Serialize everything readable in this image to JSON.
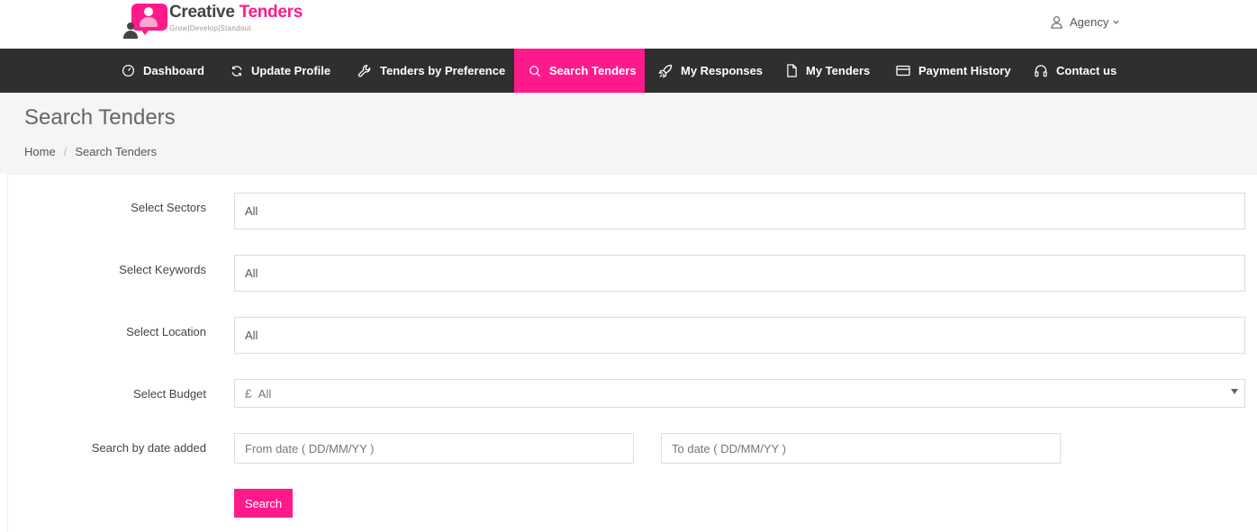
{
  "brand": {
    "name_part1": "Creative",
    "name_part2": "Tenders",
    "tagline": "Grow|Develop|Standout"
  },
  "user_menu": {
    "label": "Agency"
  },
  "nav": {
    "items": [
      {
        "label": "Dashboard",
        "icon": "gauge-icon"
      },
      {
        "label": "Update Profile",
        "icon": "refresh-icon"
      },
      {
        "label": "Tenders by Preference",
        "icon": "wrench-icon"
      },
      {
        "label": "Search Tenders",
        "icon": "search-icon",
        "active": true
      },
      {
        "label": "My Responses",
        "icon": "rocket-icon"
      },
      {
        "label": "My Tenders",
        "icon": "document-icon"
      },
      {
        "label": "Payment History",
        "icon": "credit-card-icon"
      },
      {
        "label": "Contact us",
        "icon": "headphones-icon"
      }
    ]
  },
  "page": {
    "title": "Search Tenders",
    "breadcrumb": [
      "Home",
      "Search Tenders"
    ]
  },
  "form": {
    "sectors": {
      "label": "Select Sectors",
      "value": "All"
    },
    "keywords": {
      "label": "Select Keywords",
      "value": "All"
    },
    "location": {
      "label": "Select Location",
      "value": "All"
    },
    "budget": {
      "label": "Select Budget",
      "value": "All",
      "currency_symbol": "£"
    },
    "date": {
      "label": "Search by date added",
      "from_placeholder": "From date ( DD/MM/YY )",
      "to_placeholder": "To date ( DD/MM/YY )"
    },
    "search_label": "Search"
  },
  "colors": {
    "accent": "#ff1a8c",
    "nav_bg": "#2f2f2f",
    "page_head_bg": "#f5f5f5"
  }
}
